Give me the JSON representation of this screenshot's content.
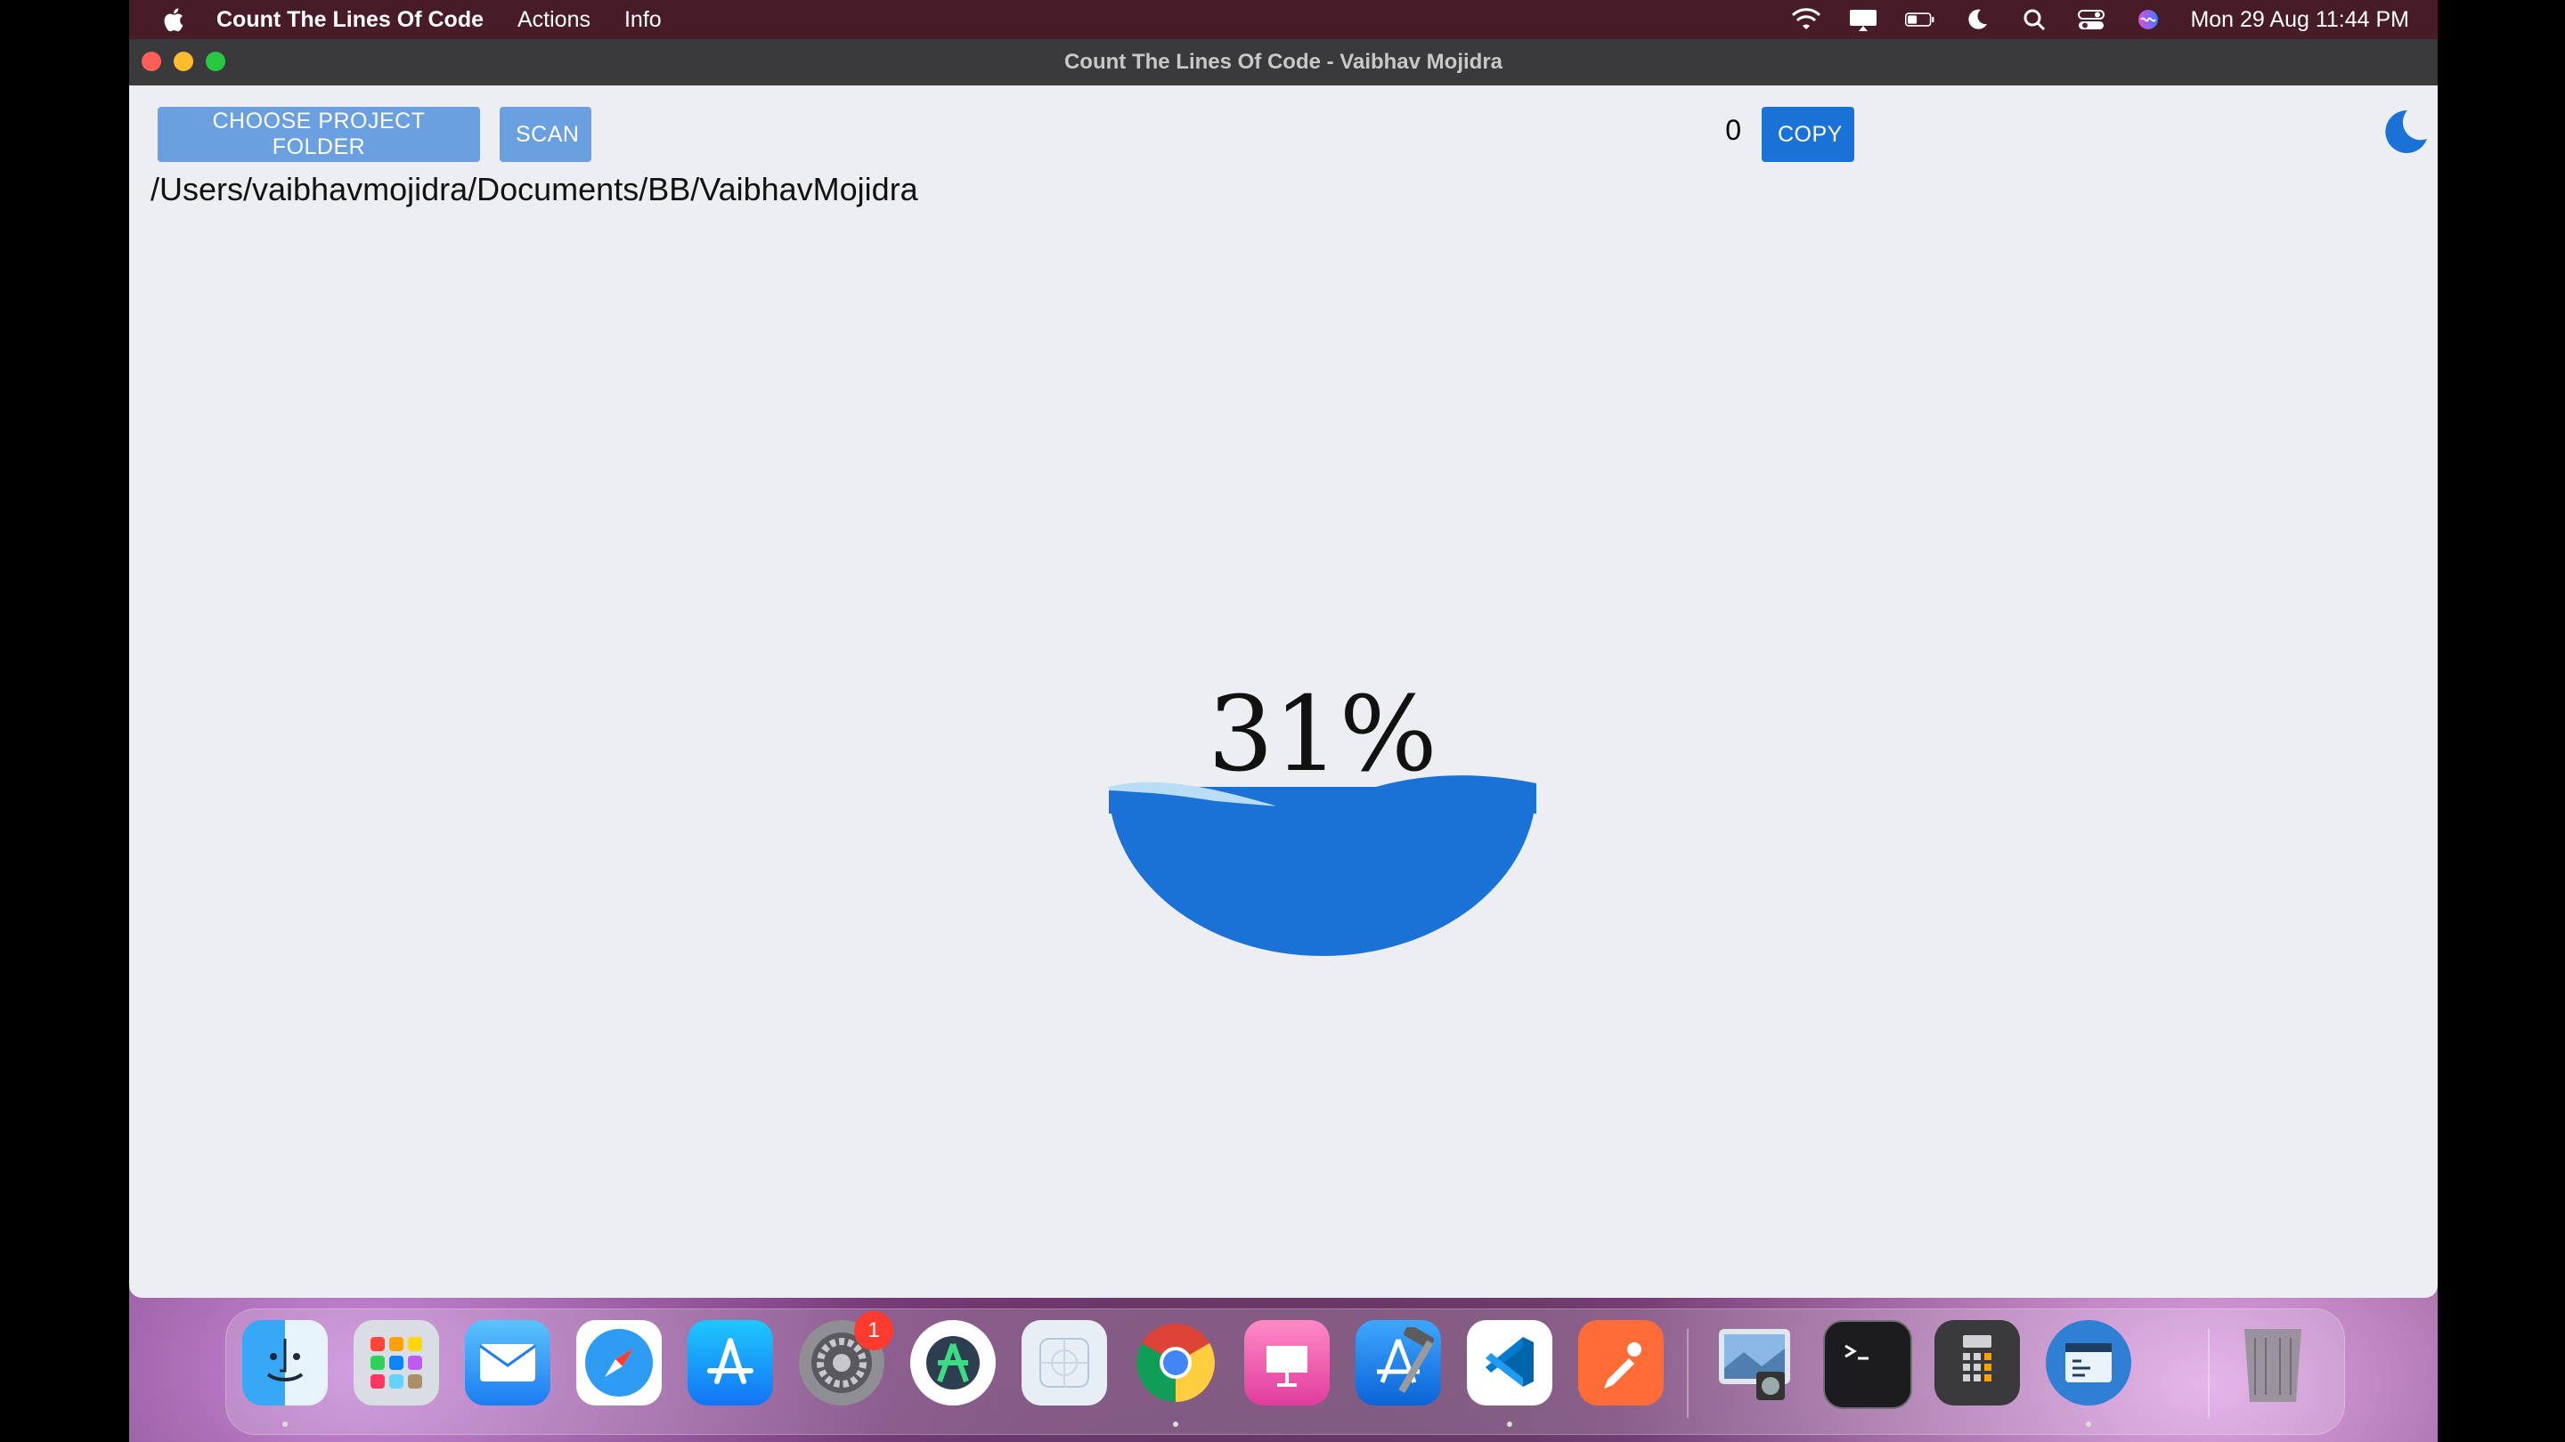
{
  "menubar": {
    "app_name": "Count The Lines Of Code",
    "menus": [
      "Actions",
      "Info"
    ],
    "clock": "Mon 29 Aug  11:44 PM",
    "status_icons": [
      "wifi-icon",
      "display-icon",
      "battery-icon",
      "focus-moon-icon",
      "spotlight-icon",
      "control-center-icon",
      "siri-icon"
    ]
  },
  "window": {
    "title": "Count The Lines Of Code - Vaibhav Mojidra"
  },
  "toolbar": {
    "choose_label": "CHOOSE PROJECT FOLDER",
    "scan_label": "SCAN",
    "count": "0",
    "copy_label": "COPY"
  },
  "folder_path": "/Users/vaibhavmojidra/Documents/BB/VaibhavMojidra",
  "progress": {
    "label": "31%",
    "value": 0.31,
    "fill_color": "#1b72d6",
    "wave_color": "#b9ddf5"
  },
  "colors": {
    "accent": "#1b72d6",
    "accent_light": "#6a9fe0",
    "window_bg": "#eceef1"
  },
  "dock": {
    "badge_system_settings": "1",
    "apps": [
      "finder",
      "launchpad",
      "mail",
      "safari",
      "app-store",
      "system-preferences",
      "android-studio",
      "simulator",
      "chrome",
      "presentation-app",
      "xcode",
      "vscode",
      "postman",
      "preview",
      "terminal",
      "calculator",
      "script-app",
      "trash"
    ]
  }
}
